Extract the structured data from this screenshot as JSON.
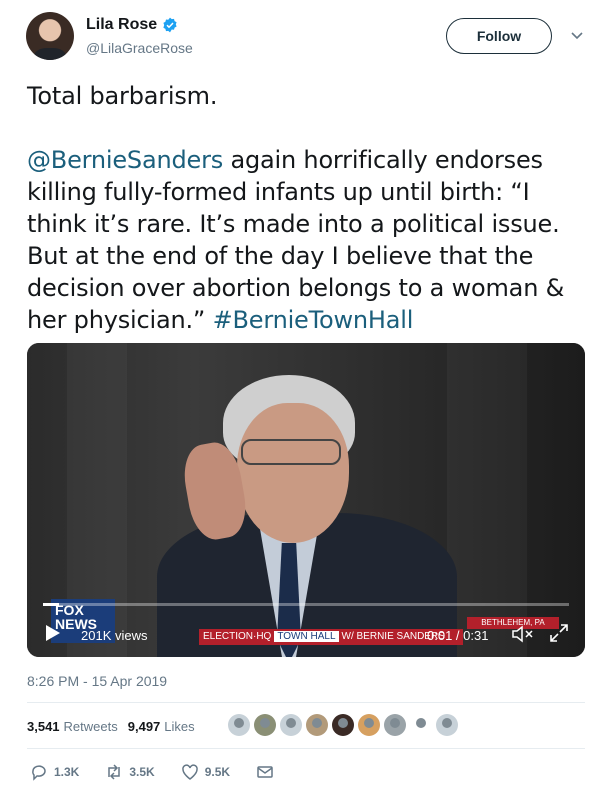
{
  "author": {
    "name": "Lila Rose",
    "handle": "@LilaGraceRose",
    "follow_label": "Follow"
  },
  "tweet": {
    "line1": "Total barbarism.",
    "mention": "@BernieSanders",
    "body": " again horrifically endorses killing fully-formed infants up until birth: “I think it’s rare. It’s made into a political issue. But at the end of the day I believe that the decision over abortion belongs to a woman & her physician.” ",
    "hashtag": "#BernieTownHall"
  },
  "video": {
    "views": "201K views",
    "time": "0:01 / 0:31",
    "progress": 0.03,
    "fox_logo": "FOX NEWS",
    "banner_text": "ELECTION·HQ",
    "banner_townhall": "TOWN HALL",
    "banner_name": "W/ BERNIE SANDERS",
    "location": "BETHLEHEM, PA"
  },
  "timestamp": "8:26 PM - 15 Apr 2019",
  "stats": {
    "retweets_count": "3,541",
    "retweets_label": "Retweets",
    "likes_count": "9,497",
    "likes_label": "Likes"
  },
  "actions": {
    "reply_count": "1.3K",
    "retweet_count": "3.5K",
    "like_count": "9.5K"
  },
  "colors": {
    "link": "#1b5f7c",
    "secondary_text": "#657786",
    "verified": "#1da1f2"
  }
}
